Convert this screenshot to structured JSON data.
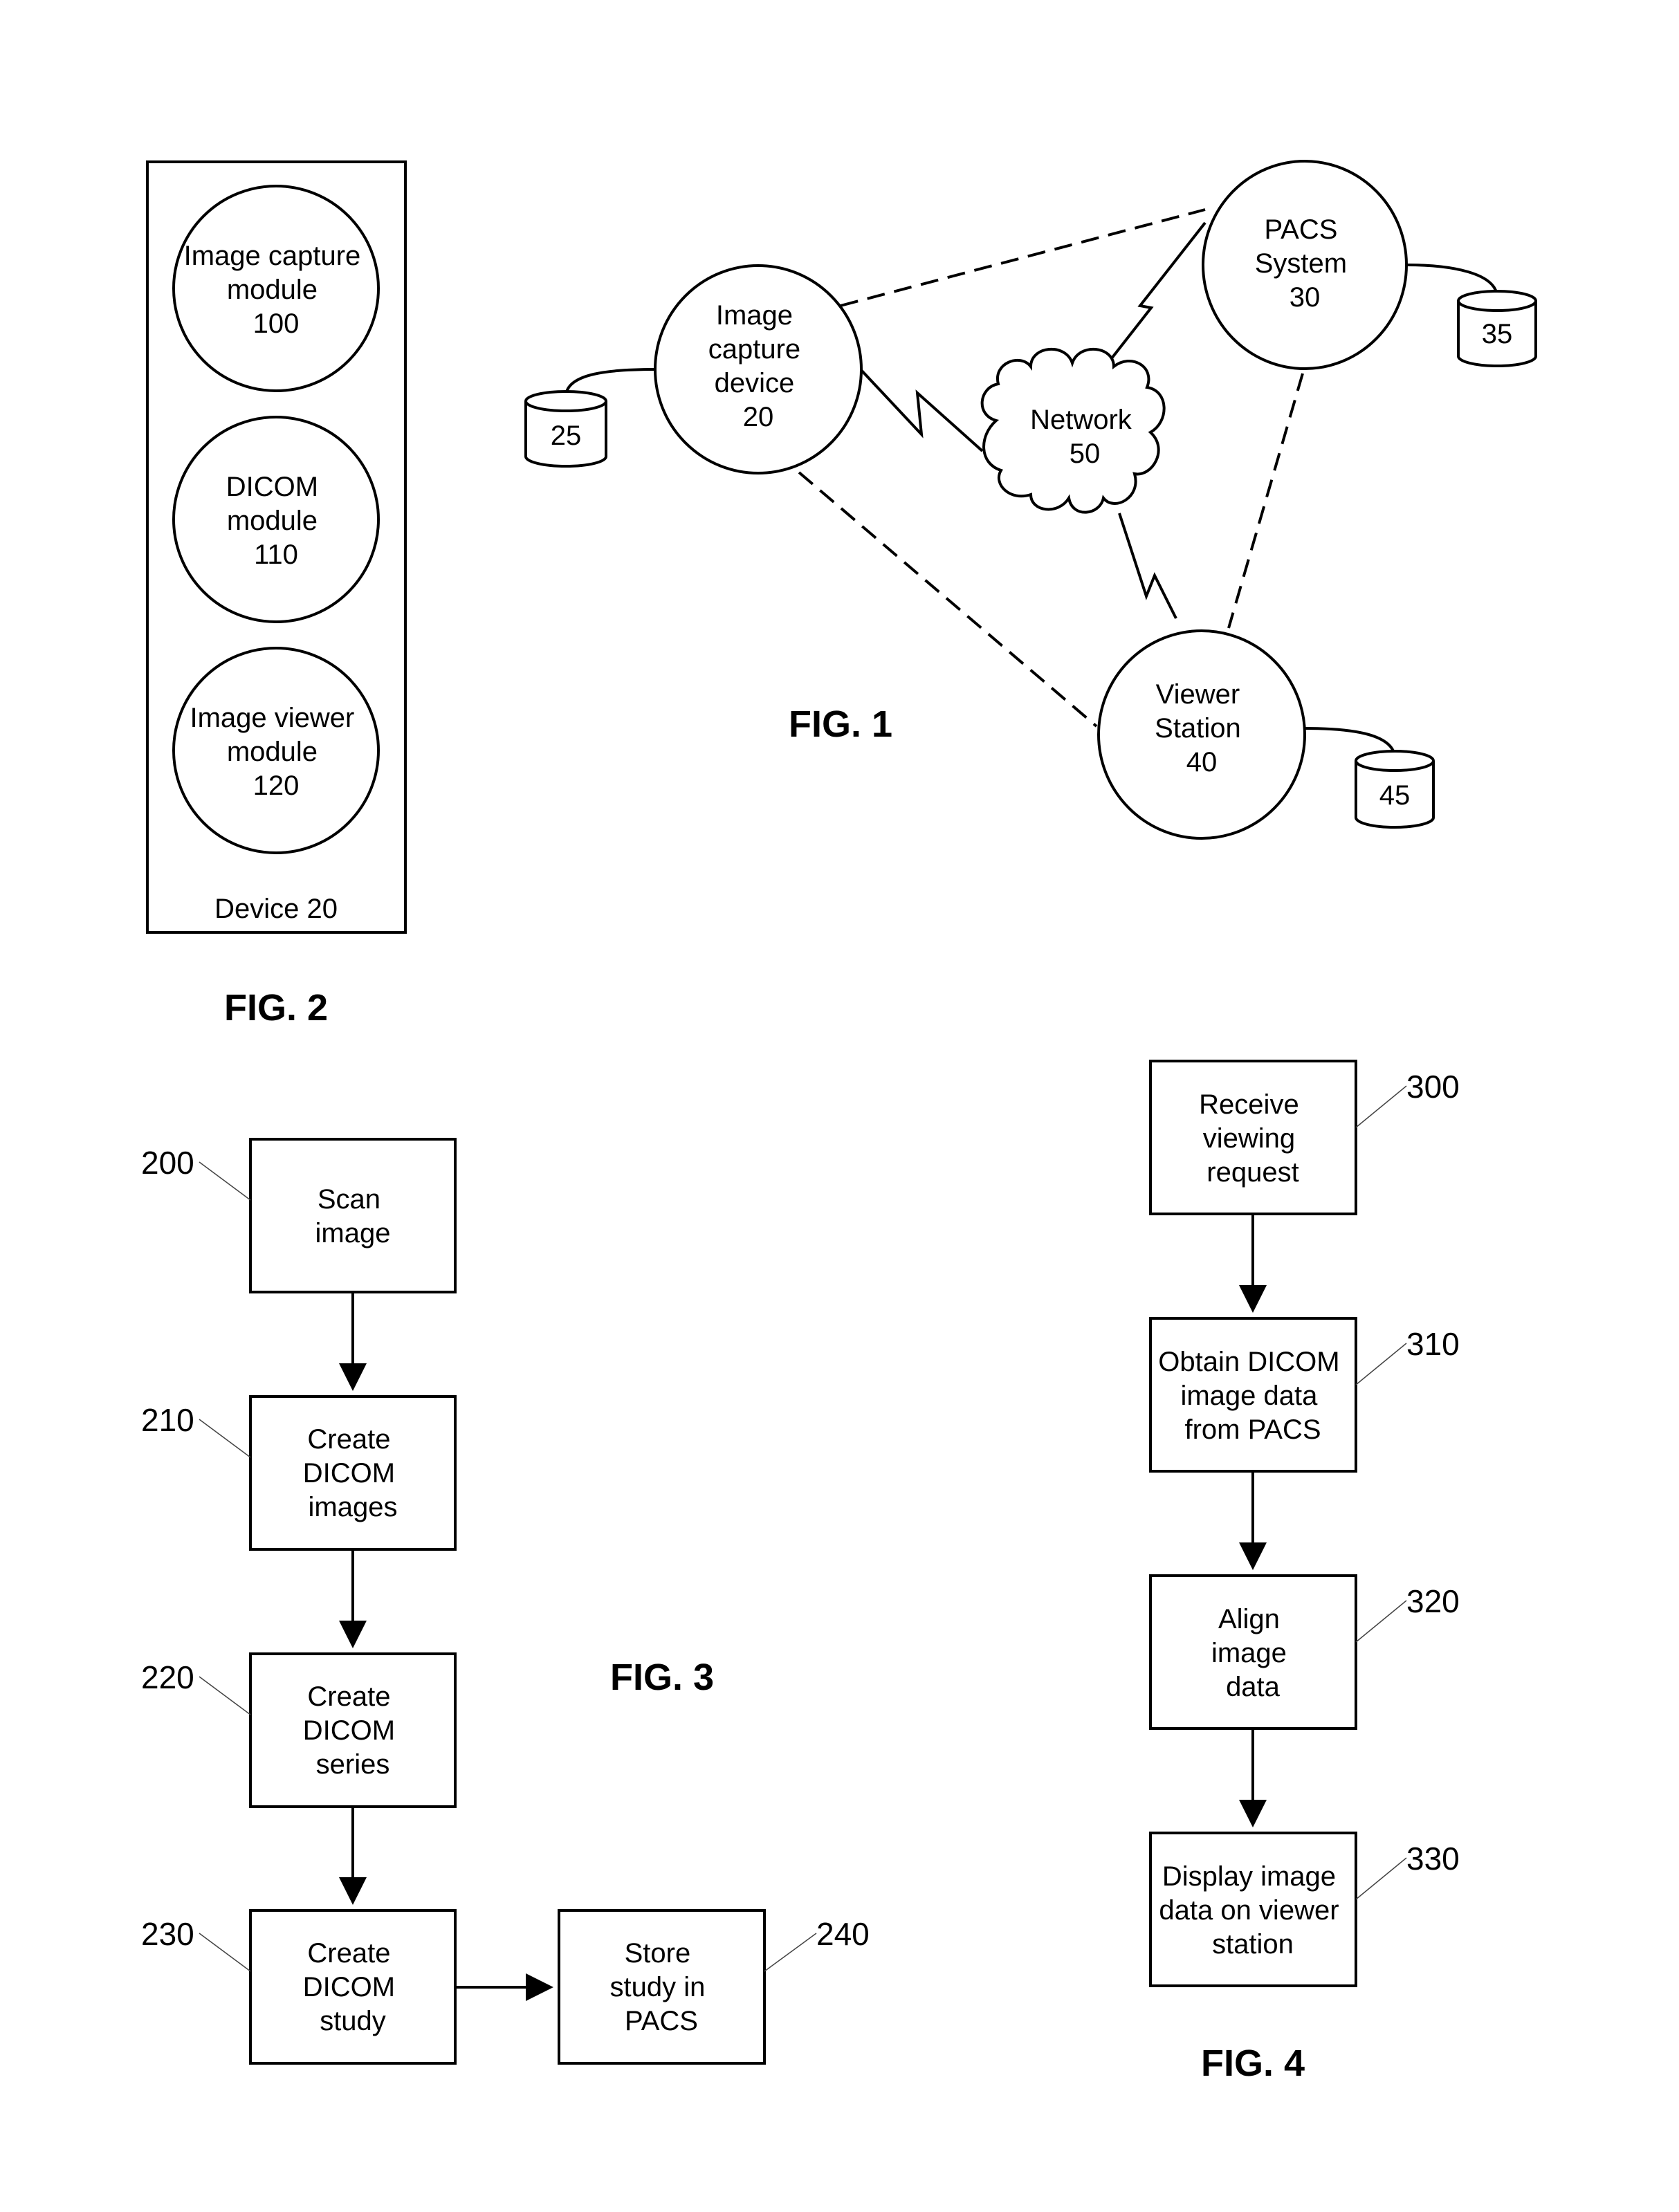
{
  "fig2": {
    "caption": "FIG. 2",
    "container_label": "Device 20",
    "modules": [
      {
        "lines": [
          "Image capture",
          "module",
          "100"
        ]
      },
      {
        "lines": [
          "DICOM",
          "module",
          "110"
        ]
      },
      {
        "lines": [
          "Image viewer",
          "module",
          "120"
        ]
      }
    ]
  },
  "fig1": {
    "caption": "FIG. 1",
    "nodes": {
      "capture": {
        "lines": [
          "Image",
          "capture",
          "device",
          "20"
        ]
      },
      "pacs": {
        "lines": [
          "PACS",
          "System",
          "30"
        ]
      },
      "viewer": {
        "lines": [
          "Viewer",
          "Station",
          "40"
        ]
      },
      "network": {
        "lines": [
          "Network",
          "50"
        ]
      }
    },
    "storage": {
      "capture_db": "25",
      "pacs_db": "35",
      "viewer_db": "45"
    },
    "connections": [
      {
        "from": "capture",
        "to": "pacs",
        "style": "dashed"
      },
      {
        "from": "capture",
        "to": "viewer",
        "style": "dashed"
      },
      {
        "from": "pacs",
        "to": "viewer",
        "style": "dashed"
      },
      {
        "from": "capture",
        "to": "network",
        "style": "wireless"
      },
      {
        "from": "network",
        "to": "pacs",
        "style": "wireless"
      },
      {
        "from": "network",
        "to": "viewer",
        "style": "wireless"
      }
    ]
  },
  "fig3": {
    "caption": "FIG. 3",
    "steps": [
      {
        "ref": "200",
        "lines": [
          "Scan",
          "image"
        ]
      },
      {
        "ref": "210",
        "lines": [
          "Create",
          "DICOM",
          "images"
        ]
      },
      {
        "ref": "220",
        "lines": [
          "Create",
          "DICOM",
          "series"
        ]
      },
      {
        "ref": "230",
        "lines": [
          "Create",
          "DICOM",
          "study"
        ]
      },
      {
        "ref": "240",
        "lines": [
          "Store",
          "study in",
          "PACS"
        ]
      }
    ]
  },
  "fig4": {
    "caption": "FIG. 4",
    "steps": [
      {
        "ref": "300",
        "lines": [
          "Receive",
          "viewing",
          "request"
        ]
      },
      {
        "ref": "310",
        "lines": [
          "Obtain DICOM",
          "image data",
          "from PACS"
        ]
      },
      {
        "ref": "320",
        "lines": [
          "Align",
          "image",
          "data"
        ]
      },
      {
        "ref": "330",
        "lines": [
          "Display image",
          "data on viewer",
          "station"
        ]
      }
    ]
  }
}
